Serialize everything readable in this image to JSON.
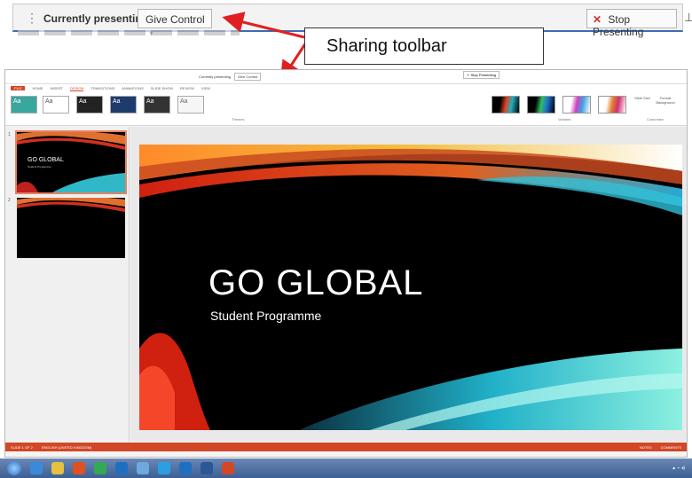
{
  "sharing_toolbar": {
    "status_label": "Currently presenting",
    "give_control_label": "Give Control",
    "stop_label": "Stop Presenting",
    "grip_glyph": "⋮",
    "dropdown_glyph": "▾",
    "stop_glyph": "✕",
    "pin_glyph": "⊥"
  },
  "callout": {
    "text": "Sharing toolbar",
    "arrow_color": "#e02020"
  },
  "ppt": {
    "ribbon_tabs": [
      "FILE",
      "HOME",
      "INSERT",
      "DESIGN",
      "TRANSITIONS",
      "ANIMATIONS",
      "SLIDE SHOW",
      "REVIEW",
      "VIEW"
    ],
    "active_tab": "DESIGN",
    "mini_status_label": "Currently presenting",
    "mini_give_label": "Give Control",
    "mini_stop_label": "Stop Presenting",
    "themes_label": "Themes",
    "variants_label": "Variants",
    "customize_label": "Customize",
    "slide_size_label": "Slide Size",
    "format_bg_label": "Format Background",
    "theme_sample": "Aa",
    "thumbnails": [
      {
        "num": "1",
        "title": "GO GLOBAL",
        "subtitle": "Student Programme"
      },
      {
        "num": "2",
        "title": "",
        "subtitle": ""
      }
    ],
    "slide": {
      "title": "GO GLOBAL",
      "subtitle": "Student Programme"
    },
    "status_left": "SLIDE 1 OF 2",
    "status_lang": "ENGLISH (UNITED KINGDOM)",
    "status_notes": "NOTES",
    "status_comments": "COMMENTS",
    "accent_color": "#d24726"
  }
}
